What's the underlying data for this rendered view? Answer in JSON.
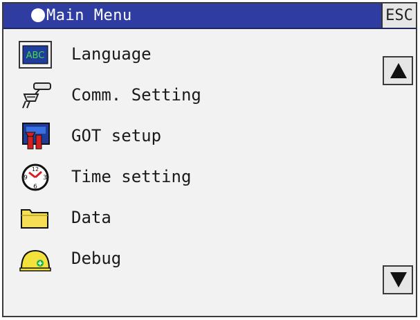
{
  "header": {
    "title": "Main Menu",
    "esc_label": "ESC"
  },
  "menu": {
    "items": [
      {
        "label": "Language",
        "icon": "language-icon",
        "icon_text": "ABC"
      },
      {
        "label": "Comm. Setting",
        "icon": "comm-setting-icon"
      },
      {
        "label": "GOT setup",
        "icon": "got-setup-icon"
      },
      {
        "label": "Time setting",
        "icon": "clock-icon",
        "icon_text": [
          "12",
          "9",
          "3",
          "6"
        ]
      },
      {
        "label": "Data",
        "icon": "folder-icon"
      },
      {
        "label": "Debug",
        "icon": "debug-icon"
      }
    ]
  },
  "scroll": {
    "up_icon": "arrow-up-icon",
    "down_icon": "arrow-down-icon"
  },
  "colors": {
    "title_bar": "#2f3ca2",
    "background": "#f2f2f2",
    "button": "#e6e6e6"
  }
}
